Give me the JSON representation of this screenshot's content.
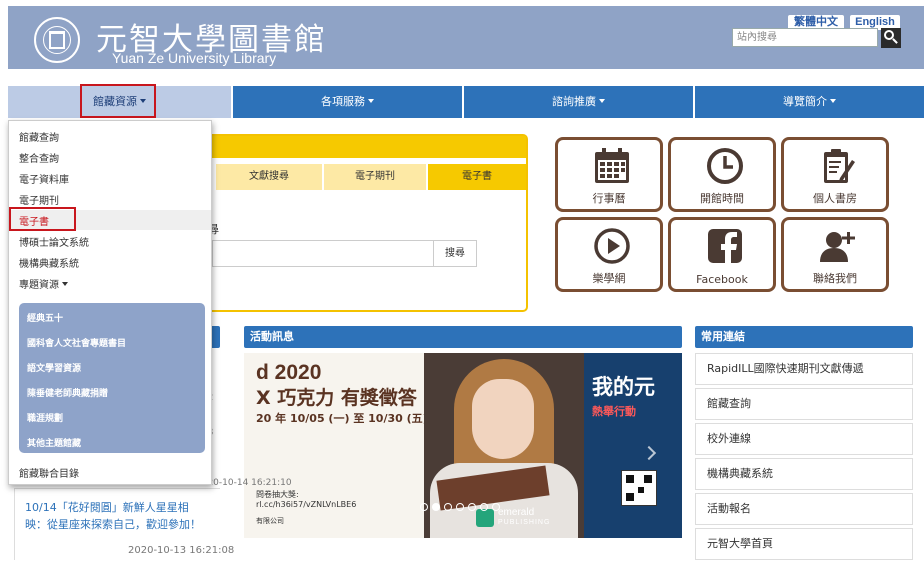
{
  "header": {
    "title_cn": "元智大學圖書館",
    "title_en": "Yuan Ze University Library",
    "lang_tc": "繁體中文",
    "lang_en": "English",
    "search_placeholder": "站內搜尋",
    "bg_color": "#8fa3c6"
  },
  "nav": {
    "holdings": "館藏資源",
    "services": "各項服務",
    "consult": "諮詢推廣",
    "guide": "導覽簡介",
    "active_color": "#bccbe5",
    "color": "#2d72b9"
  },
  "dropdown": {
    "items": [
      "館藏查詢",
      "整合查詢",
      "電子資料庫",
      "電子期刊",
      "電子書",
      "博碩士論文系統",
      "機構典藏系統",
      "專題資源"
    ],
    "selected": "電子書",
    "sub_items": [
      "經典五十",
      "國科會人文社會專題書目",
      "語文學習資源",
      "陳垂健老師典藏捐贈",
      "職涯規劃",
      "其他主題館藏"
    ],
    "last_item": "館藏聯合目錄"
  },
  "search_panel": {
    "tabs": [
      "文獻搜尋",
      "電子期刊",
      "電子書"
    ],
    "active_tab": "電子書",
    "submit": "搜尋",
    "partial_char": "尋",
    "accent": "#f6c900"
  },
  "tiles": [
    {
      "label": "行事曆",
      "icon": "calendar-icon"
    },
    {
      "label": "開館時間",
      "icon": "clock-icon"
    },
    {
      "label": "個人書房",
      "icon": "clipboard-pen-icon"
    },
    {
      "label": "樂學網",
      "icon": "play-icon"
    },
    {
      "label": "Facebook",
      "icon": "facebook-icon"
    },
    {
      "label": "聯絡我們",
      "icon": "add-user-icon"
    }
  ],
  "sections": {
    "events": "活動訊息",
    "links": "常用連結"
  },
  "banner": {
    "line1": "d 2020",
    "line2": "X 巧克力 有獎徵答",
    "line3": "20 年 10/05 (一) 至 10/30 (五)",
    "line4": "問卷抽大獎:",
    "line5": "rl.cc/h36i57/vZNLVnLBE6",
    "line6": "有限公司",
    "right1": "我的元",
    "right2": "熱舉行動",
    "brand": "emerald",
    "brand_sub": "PUBLISHING"
  },
  "quick_links": [
    "RapidILL國際快速期刊文獻傳遞",
    "館藏查詢",
    "校外連線",
    "機構典藏系統",
    "活動報名",
    "元智大學首頁"
  ],
  "news": {
    "date_frag1": "2",
    "date_frag2": "8",
    "date_frag3": "2020-10-14 16:21:10",
    "link": "10/14「花好閱圓」新鮮人星星相映：從星座來探索自己，歡迎參加！",
    "timestamp": "2020-10-13 16:21:08"
  }
}
